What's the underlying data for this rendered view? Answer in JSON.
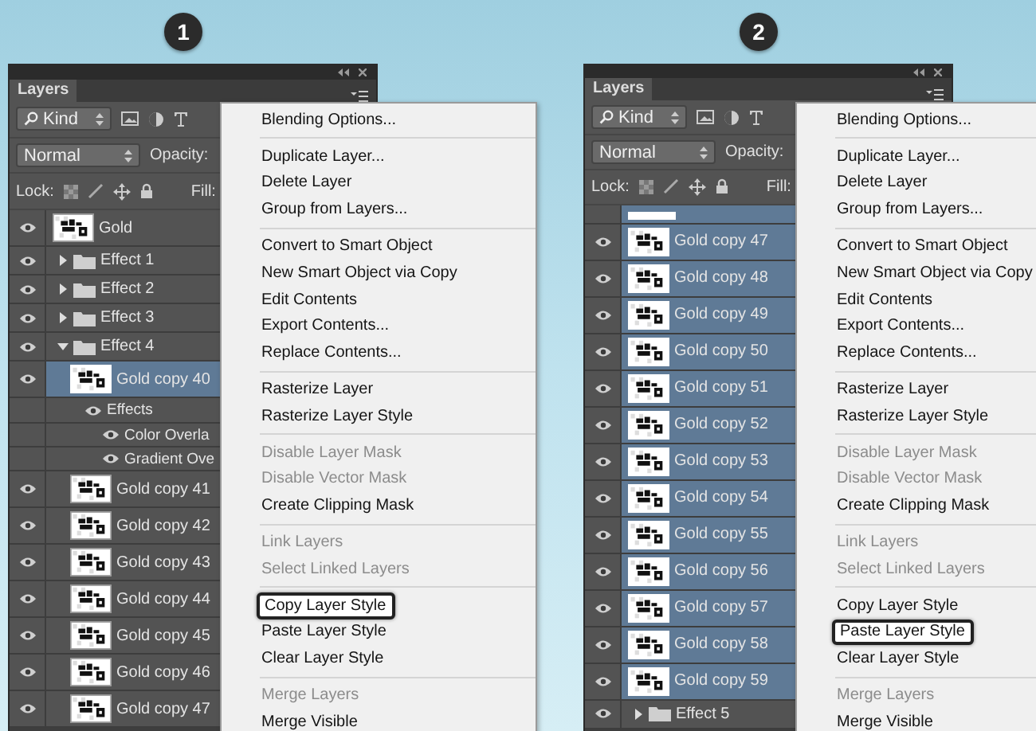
{
  "panels": [
    {
      "badge": "1",
      "tab": "Layers",
      "filter": "Kind",
      "blend_mode": "Normal",
      "opacity_label": "Opacity:",
      "lock_label": "Lock:",
      "fill_label": "Fill:",
      "layers": [
        {
          "kind": "layer",
          "name": "Gold",
          "selected": false
        },
        {
          "kind": "group",
          "name": "Effect 1",
          "expanded": false,
          "selected": false
        },
        {
          "kind": "group",
          "name": "Effect 2",
          "expanded": false,
          "selected": false
        },
        {
          "kind": "group",
          "name": "Effect 3",
          "expanded": false,
          "selected": false
        },
        {
          "kind": "group",
          "name": "Effect 4",
          "expanded": true,
          "selected": false,
          "children": [
            {
              "kind": "layer",
              "name": "Gold copy 40",
              "selected": true,
              "children": [
                {
                  "kind": "effects",
                  "name": "Effects",
                  "children": [
                    {
                      "kind": "effect",
                      "name": "Color Overla"
                    },
                    {
                      "kind": "effect",
                      "name": "Gradient Ove"
                    }
                  ]
                }
              ]
            },
            {
              "kind": "layer",
              "name": "Gold copy 41",
              "selected": false
            },
            {
              "kind": "layer",
              "name": "Gold copy 42",
              "selected": false
            },
            {
              "kind": "layer",
              "name": "Gold copy 43",
              "selected": false
            },
            {
              "kind": "layer",
              "name": "Gold copy 44",
              "selected": false
            },
            {
              "kind": "layer",
              "name": "Gold copy 45",
              "selected": false
            },
            {
              "kind": "layer",
              "name": "Gold copy 46",
              "selected": false
            },
            {
              "kind": "layer",
              "name": "Gold copy 47",
              "selected": false
            }
          ]
        }
      ],
      "menu": [
        [
          {
            "label": "Blending Options...",
            "disabled": false,
            "highlighted": false
          }
        ],
        [
          {
            "label": "Duplicate Layer...",
            "disabled": false,
            "highlighted": false
          },
          {
            "label": "Delete Layer",
            "disabled": false,
            "highlighted": false
          },
          {
            "label": "Group from Layers...",
            "disabled": false,
            "highlighted": false
          }
        ],
        [
          {
            "label": "Convert to Smart Object",
            "disabled": false,
            "highlighted": false
          },
          {
            "label": "New Smart Object via Copy",
            "disabled": false,
            "highlighted": false
          },
          {
            "label": "Edit Contents",
            "disabled": false,
            "highlighted": false
          },
          {
            "label": "Export Contents...",
            "disabled": false,
            "highlighted": false
          },
          {
            "label": "Replace Contents...",
            "disabled": false,
            "highlighted": false
          }
        ],
        [
          {
            "label": "Rasterize Layer",
            "disabled": false,
            "highlighted": false
          },
          {
            "label": "Rasterize Layer Style",
            "disabled": false,
            "highlighted": false
          }
        ],
        [
          {
            "label": "Disable Layer Mask",
            "disabled": true,
            "highlighted": false
          },
          {
            "label": "Disable Vector Mask",
            "disabled": true,
            "highlighted": false
          },
          {
            "label": "Create Clipping Mask",
            "disabled": false,
            "highlighted": false
          }
        ],
        [
          {
            "label": "Link Layers",
            "disabled": true,
            "highlighted": false
          },
          {
            "label": "Select Linked Layers",
            "disabled": true,
            "highlighted": false
          }
        ],
        [
          {
            "label": "Copy Layer Style",
            "disabled": false,
            "highlighted": true
          },
          {
            "label": "Paste Layer Style",
            "disabled": false,
            "highlighted": false
          },
          {
            "label": "Clear Layer Style",
            "disabled": false,
            "highlighted": false
          }
        ],
        [
          {
            "label": "Merge Layers",
            "disabled": true,
            "highlighted": false
          },
          {
            "label": "Merge Visible",
            "disabled": false,
            "highlighted": false
          }
        ]
      ]
    },
    {
      "badge": "2",
      "tab": "Layers",
      "filter": "Kind",
      "blend_mode": "Normal",
      "opacity_label": "Opacity:",
      "lock_label": "Lock:",
      "fill_label": "Fill:",
      "layers": [
        {
          "kind": "partial",
          "selected": true
        },
        {
          "kind": "layer",
          "name": "Gold copy 47",
          "selected": true
        },
        {
          "kind": "layer",
          "name": "Gold copy 48",
          "selected": true
        },
        {
          "kind": "layer",
          "name": "Gold copy 49",
          "selected": true
        },
        {
          "kind": "layer",
          "name": "Gold copy 50",
          "selected": true
        },
        {
          "kind": "layer",
          "name": "Gold copy 51",
          "selected": true
        },
        {
          "kind": "layer",
          "name": "Gold copy 52",
          "selected": true
        },
        {
          "kind": "layer",
          "name": "Gold copy 53",
          "selected": true
        },
        {
          "kind": "layer",
          "name": "Gold copy 54",
          "selected": true
        },
        {
          "kind": "layer",
          "name": "Gold copy 55",
          "selected": true
        },
        {
          "kind": "layer",
          "name": "Gold copy 56",
          "selected": true
        },
        {
          "kind": "layer",
          "name": "Gold copy 57",
          "selected": true
        },
        {
          "kind": "layer",
          "name": "Gold copy 58",
          "selected": true
        },
        {
          "kind": "layer",
          "name": "Gold copy 59",
          "selected": true
        },
        {
          "kind": "group",
          "name": "Effect 5",
          "expanded": false,
          "selected": false
        }
      ],
      "menu": [
        [
          {
            "label": "Blending Options...",
            "disabled": false,
            "highlighted": false
          }
        ],
        [
          {
            "label": "Duplicate Layer...",
            "disabled": false,
            "highlighted": false
          },
          {
            "label": "Delete Layer",
            "disabled": false,
            "highlighted": false
          },
          {
            "label": "Group from Layers...",
            "disabled": false,
            "highlighted": false
          }
        ],
        [
          {
            "label": "Convert to Smart Object",
            "disabled": false,
            "highlighted": false
          },
          {
            "label": "New Smart Object via Copy",
            "disabled": false,
            "highlighted": false
          },
          {
            "label": "Edit Contents",
            "disabled": false,
            "highlighted": false
          },
          {
            "label": "Export Contents...",
            "disabled": false,
            "highlighted": false
          },
          {
            "label": "Replace Contents...",
            "disabled": false,
            "highlighted": false
          }
        ],
        [
          {
            "label": "Rasterize Layer",
            "disabled": false,
            "highlighted": false
          },
          {
            "label": "Rasterize Layer Style",
            "disabled": false,
            "highlighted": false
          }
        ],
        [
          {
            "label": "Disable Layer Mask",
            "disabled": true,
            "highlighted": false
          },
          {
            "label": "Disable Vector Mask",
            "disabled": true,
            "highlighted": false
          },
          {
            "label": "Create Clipping Mask",
            "disabled": false,
            "highlighted": false
          }
        ],
        [
          {
            "label": "Link Layers",
            "disabled": true,
            "highlighted": false
          },
          {
            "label": "Select Linked Layers",
            "disabled": true,
            "highlighted": false
          }
        ],
        [
          {
            "label": "Copy Layer Style",
            "disabled": false,
            "highlighted": false
          },
          {
            "label": "Paste Layer Style",
            "disabled": false,
            "highlighted": true
          },
          {
            "label": "Clear Layer Style",
            "disabled": false,
            "highlighted": false
          }
        ],
        [
          {
            "label": "Merge Layers",
            "disabled": true,
            "highlighted": false
          },
          {
            "label": "Merge Visible",
            "disabled": false,
            "highlighted": false
          }
        ]
      ]
    }
  ]
}
